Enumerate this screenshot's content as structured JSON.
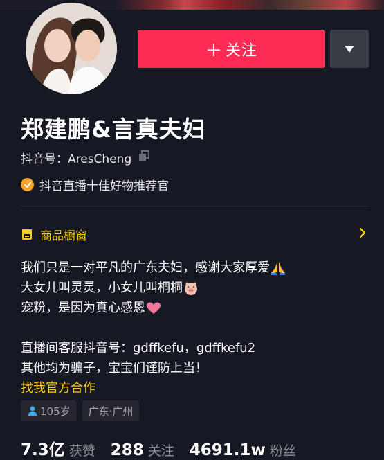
{
  "profile": {
    "name": "郑建鹏&言真夫妇",
    "douyin_id_label": "抖音号：AresCheng",
    "verification": "抖音直播十佳好物推荐官"
  },
  "actions": {
    "follow_label": "关注",
    "follow_plus": "＋"
  },
  "shop": {
    "label": "商品橱窗"
  },
  "bio": {
    "line1": "我们只是一对平凡的广东夫妇，感谢大家厚爱",
    "line2": "大女儿叫灵灵，小女儿叫桐桐",
    "line3": "宠粉，是因为真心感恩",
    "line4": "直播间客服抖音号：gdffkefu，gdffkefu2",
    "line5": "其他均为骗子，宝宝们谨防上当！",
    "link": "找我官方合作"
  },
  "tags": {
    "age": "105岁",
    "location": "广东·广州"
  },
  "stats": {
    "likes_value": "7.3亿",
    "likes_label": "获赞",
    "following_value": "288",
    "following_label": "关注",
    "followers_value": "4691.1w",
    "followers_label": "粉丝"
  },
  "colors": {
    "background": "#161823",
    "follow_button": "#fe2c55",
    "accent_yellow": "#face15",
    "badge_orange": "#f8a12b",
    "heart_pink": "#f2769a"
  },
  "icons": {
    "copy": "copy-icon",
    "verify": "verified-badge-icon",
    "shop": "shop-window-icon",
    "chevron": "chevron-right-icon",
    "dropdown": "caret-down-icon",
    "pray": "praying-hands-emoji",
    "pig": "pig-face-emoji",
    "heart": "heart-emoji",
    "person": "person-icon"
  }
}
